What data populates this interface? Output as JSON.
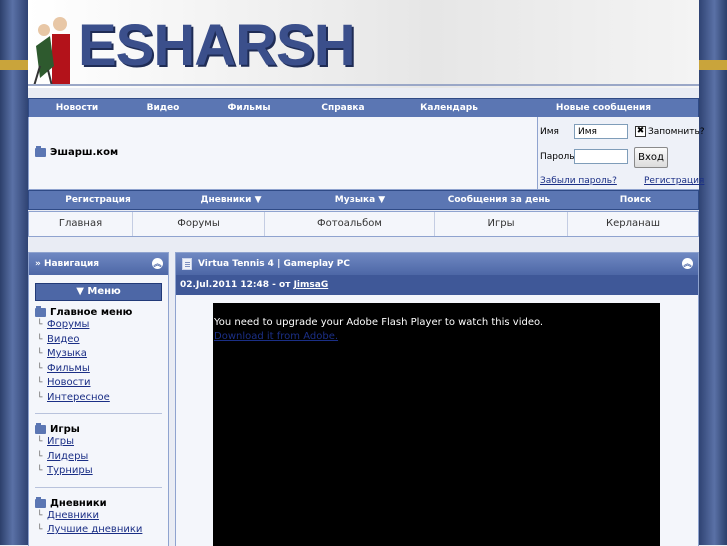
{
  "header": {
    "logo_text": "ESHARSH"
  },
  "top_menu": {
    "items": [
      "Новости",
      "Видео",
      "Фильмы",
      "Справка",
      "Календарь",
      "Новые сообщения"
    ]
  },
  "login": {
    "site_name": "Эшарш.ком",
    "name_label": "Имя",
    "name_value": "Имя",
    "remember_label": "Запомнить?",
    "password_label": "Пароль",
    "login_button": "Вход",
    "forgot_link": "Забыли пароль?",
    "register_link": "Регистрация"
  },
  "sub_menu": {
    "items": [
      "Регистрация",
      "Дневники ▼",
      "Музыка ▼",
      "Сообщения за день",
      "Поиск"
    ]
  },
  "tabs": {
    "items": [
      "Главная",
      "Форумы",
      "Фотоальбом",
      "Игры",
      "Керланаш"
    ]
  },
  "sidebar": {
    "title": "» Навигация",
    "menu_button": "▼ Меню",
    "groups": [
      {
        "title": "Главное меню",
        "items": [
          "Форумы",
          "Видео",
          "Музыка",
          "Фильмы",
          "Новости",
          "Интересное"
        ]
      },
      {
        "title": "Игры",
        "items": [
          "Игры",
          "Лидеры",
          "Турниры"
        ]
      },
      {
        "title": "Дневники",
        "items": [
          "Дневники",
          "Лучшие дневники"
        ]
      }
    ]
  },
  "post": {
    "title": "Virtua Tennis 4 | Gameplay PC",
    "date_prefix": "02.Jul.2011 12:48 - от ",
    "author": "JimsaG",
    "video_message": "You need to upgrade your Adobe Flash Player to watch this video.",
    "video_link": "Download it from Adobe."
  }
}
